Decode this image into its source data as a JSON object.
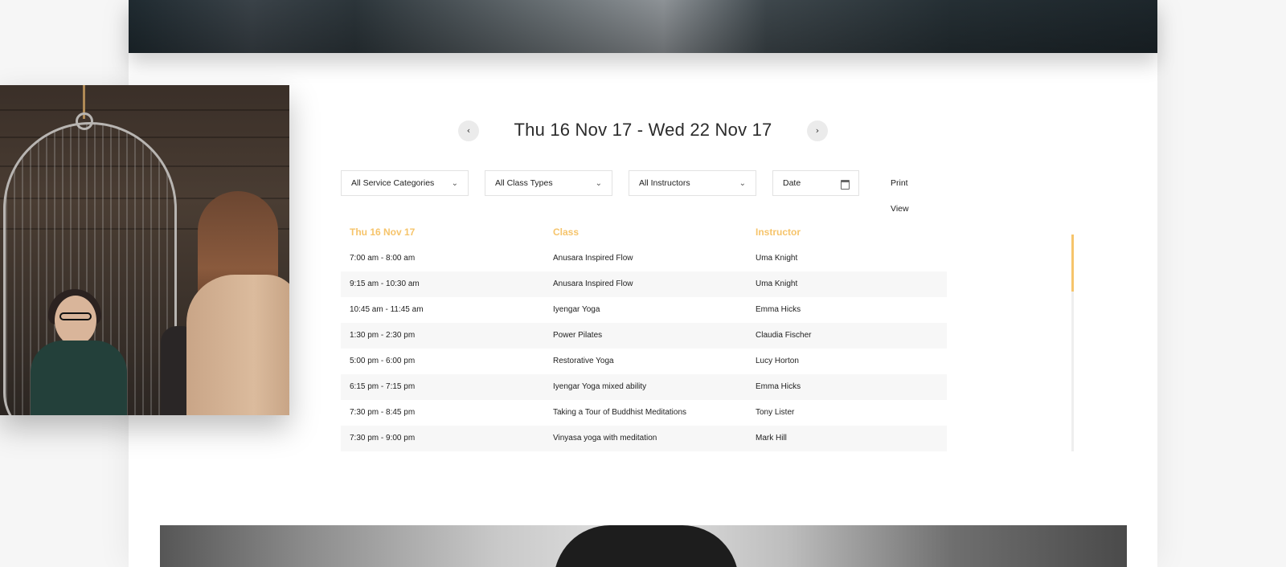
{
  "week_nav": {
    "prev_icon": "chevron-left-icon",
    "prev_glyph": "‹",
    "title": "Thu 16 Nov 17 - Wed 22 Nov 17",
    "next_icon": "chevron-right-icon",
    "next_glyph": "›"
  },
  "filters": {
    "service_categories": "All Service Categories",
    "class_types": "All Class Types",
    "instructors": "All Instructors",
    "date_placeholder": "Date",
    "dropdown_glyph": "⌄",
    "print_view": "Print View"
  },
  "schedule": {
    "headers": {
      "day": "Thu 16 Nov 17",
      "class": "Class",
      "instructor": "Instructor"
    },
    "rows": [
      {
        "time": "7:00 am - 8:00 am",
        "class": "Anusara Inspired Flow",
        "instructor": "Uma Knight"
      },
      {
        "time": "9:15 am - 10:30 am",
        "class": "Anusara Inspired Flow",
        "instructor": "Uma Knight"
      },
      {
        "time": "10:45 am - 11:45 am",
        "class": "Iyengar Yoga",
        "instructor": "Emma Hicks"
      },
      {
        "time": "1:30 pm - 2:30 pm",
        "class": "Power Pilates",
        "instructor": "Claudia Fischer"
      },
      {
        "time": "5:00 pm - 6:00 pm",
        "class": "Restorative Yoga",
        "instructor": "Lucy Horton"
      },
      {
        "time": "6:15 pm - 7:15 pm",
        "class": "Iyengar Yoga mixed ability",
        "instructor": "Emma Hicks"
      },
      {
        "time": "7:30 pm - 8:45 pm",
        "class": "Taking a Tour of Buddhist Meditations",
        "instructor": "Tony Lister"
      },
      {
        "time": "7:30 pm - 9:00 pm",
        "class": "Vinyasa yoga with meditation",
        "instructor": "Mark Hill"
      }
    ]
  },
  "colors": {
    "accent": "#f6c46b",
    "row_alt": "#f7f7f7",
    "card_bg": "#ffffff",
    "page_bg": "#f6f6f6"
  }
}
